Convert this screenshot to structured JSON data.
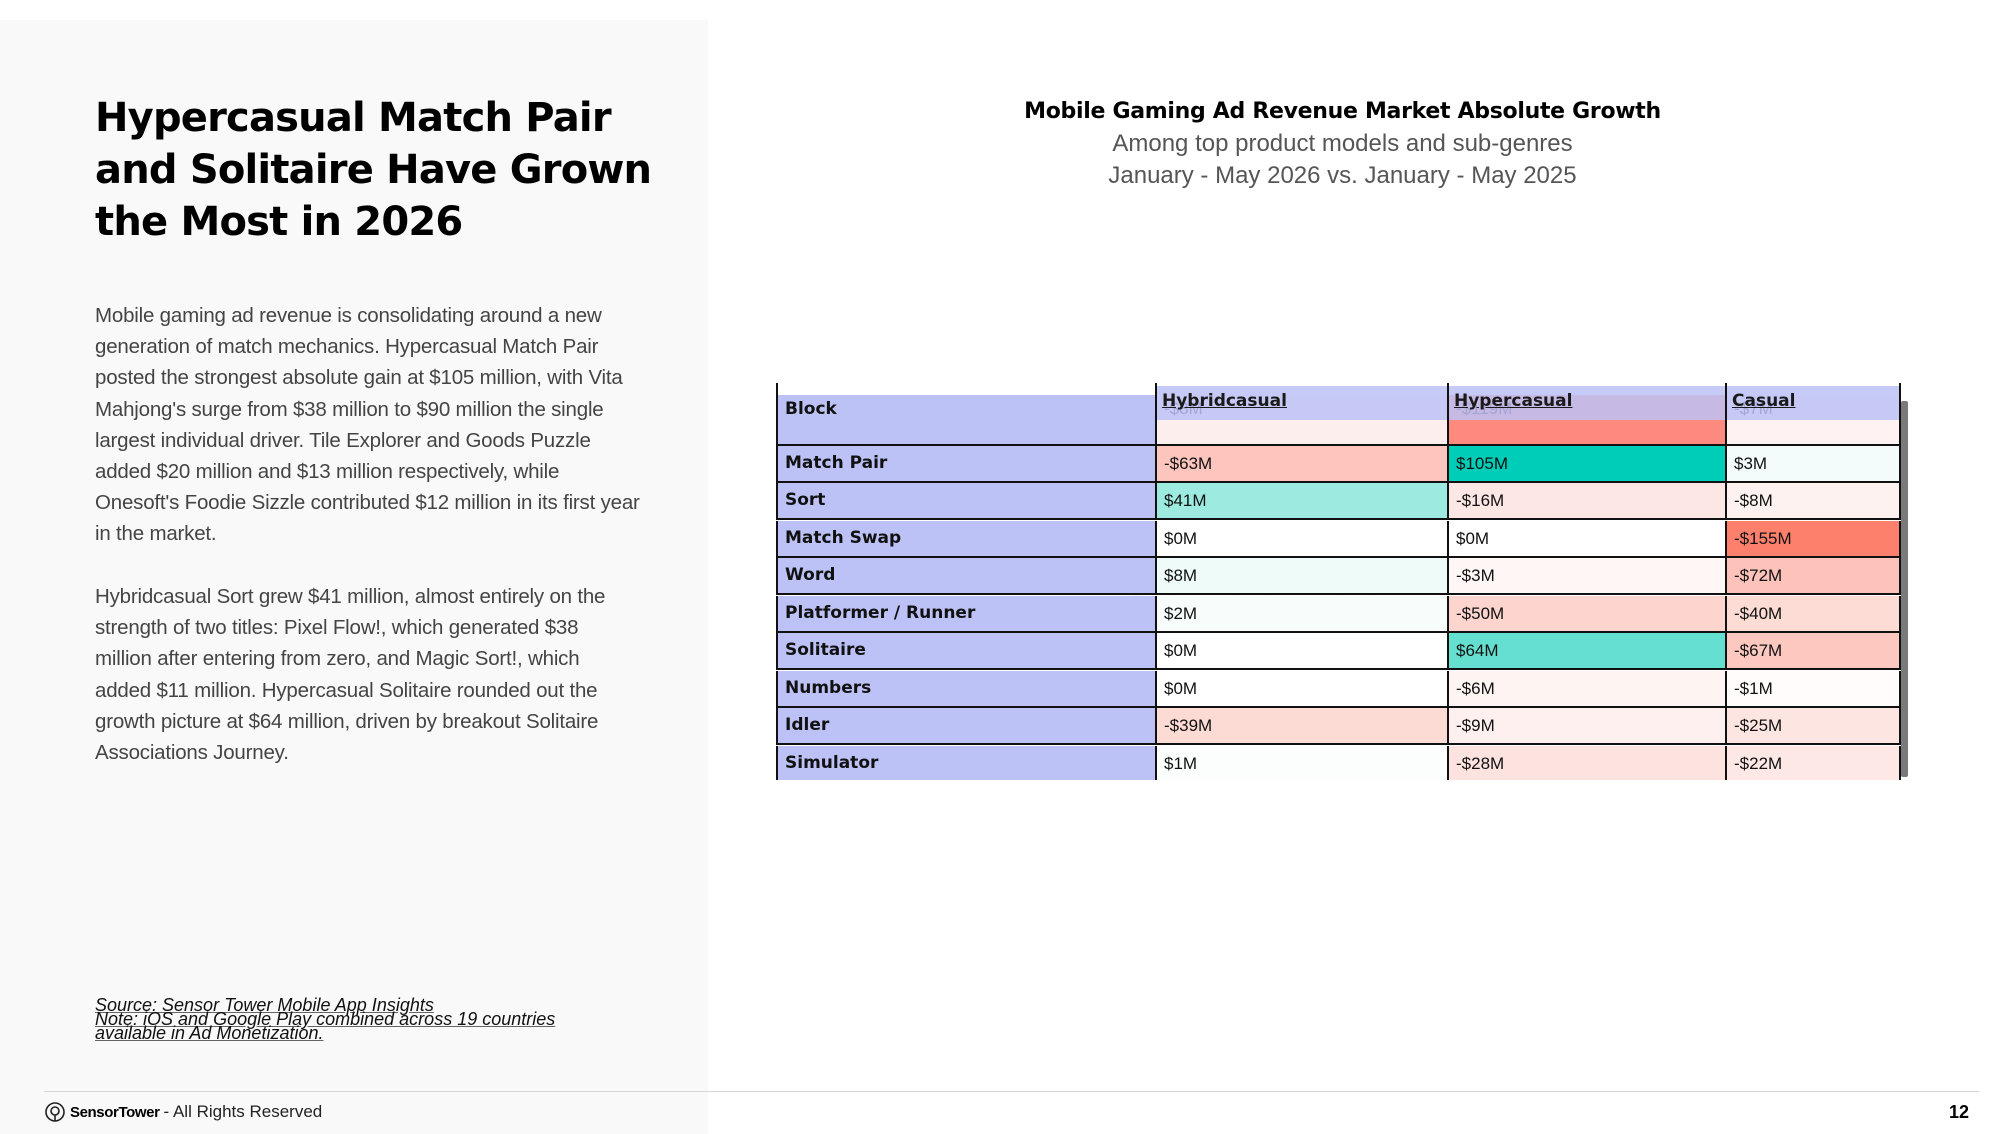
{
  "headline": "Hypercasual Match Pair and Solitaire Have Grown the Most in 2026",
  "paragraphs": [
    "Mobile gaming ad revenue is consolidating around a new generation of match mechanics. Hypercasual Match Pair posted the strongest absolute gain at $105 million, with Vita Mahjong's surge from $38 million to $90 million the single largest individual driver. Tile Explorer and Goods Puzzle added $20 million and $13 million respectively, while Onesoft's Foodie Sizzle contributed $12 million in its first year in the market.",
    "Hybridcasual Sort grew $41 million, almost entirely on the strength of two titles: Pixel Flow!, which generated $38 million after entering from zero, and Magic Sort!, which added $11 million. Hypercasual Solitaire rounded out the growth picture at $64 million, driven by breakout Solitaire Associations Journey."
  ],
  "footnotes": {
    "source": "Source: Sensor Tower Mobile App Insights",
    "note_line1": "Note: iOS and Google Play combined across 19 countries",
    "note_line2": "available in Ad Monetization."
  },
  "footer": {
    "brand": "SensorTower",
    "rights": "- All Rights Reserved",
    "page": "12"
  },
  "chart": {
    "title": "Mobile Gaming Ad Revenue Market Absolute Growth",
    "subtitle1": "Among top product models and sub-genres",
    "subtitle2": "January - May 2026 vs. January - May 2025",
    "watermark": "Sensor Tower"
  },
  "table": {
    "columns": [
      "Hybridcasual",
      "Hypercasual",
      "Casual"
    ],
    "rows": [
      {
        "label": "Block",
        "values": [
          "-$8M",
          "-$119M",
          "-$7M"
        ],
        "colors": [
          "#fdeeee",
          "#fd8a7e",
          "#fef3f2"
        ]
      },
      {
        "label": "Match Pair",
        "values": [
          "-$63M",
          "$105M",
          "$3M"
        ],
        "colors": [
          "#fdc5bd",
          "#00cdb7",
          "#f3fcfb"
        ]
      },
      {
        "label": "Sort",
        "values": [
          "$41M",
          "-$16M",
          "-$8M"
        ],
        "colors": [
          "#9deae0",
          "#fde7e4",
          "#fdf2f0"
        ]
      },
      {
        "label": "Match Swap",
        "values": [
          "$0M",
          "$0M",
          "-$155M"
        ],
        "colors": [
          "#ffffff",
          "#ffffff",
          "#fd806d"
        ]
      },
      {
        "label": "Word",
        "values": [
          "$8M",
          "-$3M",
          "-$72M"
        ],
        "colors": [
          "#eefbf8",
          "#fef7f6",
          "#fdc2b9"
        ]
      },
      {
        "label": "Platformer / Runner",
        "values": [
          "$2M",
          "-$50M",
          "-$40M"
        ],
        "colors": [
          "#f8fdfc",
          "#fdd4ce",
          "#fddcd6"
        ]
      },
      {
        "label": "Solitaire",
        "values": [
          "$0M",
          "$64M",
          "-$67M"
        ],
        "colors": [
          "#ffffff",
          "#65e0d0",
          "#fdc8c0"
        ]
      },
      {
        "label": "Numbers",
        "values": [
          "$0M",
          "-$6M",
          "-$1M"
        ],
        "colors": [
          "#ffffff",
          "#fef4f2",
          "#fffcfb"
        ]
      },
      {
        "label": "Idler",
        "values": [
          "-$39M",
          "-$9M",
          "-$25M"
        ],
        "colors": [
          "#fddbd5",
          "#fdf0ee",
          "#fde6e2"
        ]
      },
      {
        "label": "Simulator",
        "values": [
          "$1M",
          "-$28M",
          "-$22M"
        ],
        "colors": [
          "#fcfefe",
          "#fde3df",
          "#fde8e5"
        ]
      }
    ]
  }
}
